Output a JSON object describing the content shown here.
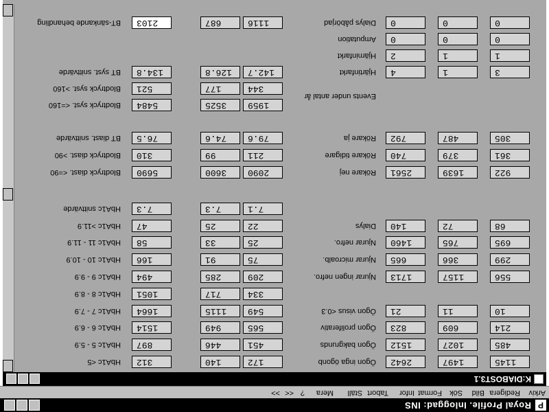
{
  "app": {
    "title": "Royal Profile. Inloggad: INS",
    "logo": "P"
  },
  "menu": [
    "Arkiv",
    "Redigera",
    "Bild",
    "Sök",
    "Format",
    "Infor",
    "Tabort",
    "Ställ",
    "Mera",
    "?",
    "<<",
    ">>"
  ],
  "document": {
    "title": "K:DIABOST3.1"
  },
  "left_section": {
    "groups": [
      {
        "rows": [
          {
            "label": "BT-sänkande behandling",
            "values": [
              "2103",
              "687",
              "1116"
            ]
          }
        ]
      },
      {
        "rows": [
          {
            "label": "BT syst. snittvärde",
            "values": [
              "134.8",
              "126.8",
              "142.7"
            ]
          },
          {
            "label": "Blodtryck syst. >160",
            "values": [
              "521",
              "177",
              "344"
            ]
          },
          {
            "label": "Blodtryck syst. <=160",
            "values": [
              "5484",
              "3525",
              "1959"
            ]
          }
        ]
      },
      {
        "rows": [
          {
            "label": "BT diast. snittvärde",
            "values": [
              "76.5",
              "74.6",
              "79.6"
            ]
          },
          {
            "label": "Blodtryck diast. >90",
            "values": [
              "310",
              "99",
              "211"
            ]
          },
          {
            "label": "Blodtryck diast. <=90",
            "values": [
              "5690",
              "3600",
              "2090"
            ]
          }
        ]
      },
      {
        "rows": [
          {
            "label": "HbA1c snittvärde",
            "values": [
              "7.3",
              "7.3",
              "7.1"
            ]
          },
          {
            "label": "HbA1c >11.9",
            "values": [
              "47",
              "25",
              "22"
            ]
          },
          {
            "label": "HbA1c 11 - 11.9",
            "values": [
              "58",
              "33",
              "25"
            ]
          },
          {
            "label": "HbA1c 10 - 10.9",
            "values": [
              "166",
              "91",
              "75"
            ]
          },
          {
            "label": "HbA1c 9 - 9.9",
            "values": [
              "494",
              "285",
              "209"
            ]
          },
          {
            "label": "HbA1c 8 - 8.9",
            "values": [
              "1051",
              "717",
              "334"
            ]
          },
          {
            "label": "HbA1c 7 - 7.9",
            "values": [
              "1664",
              "1115",
              "549"
            ]
          },
          {
            "label": "HbA1c 6 - 6.9",
            "values": [
              "1514",
              "949",
              "565"
            ]
          },
          {
            "label": "HbA1c 5 - 5.9",
            "values": [
              "897",
              "446",
              "451"
            ]
          },
          {
            "label": "HbA1c <5",
            "values": [
              "312",
              "140",
              "172"
            ]
          }
        ]
      }
    ]
  },
  "right_section": {
    "rows_top": [
      {
        "label": "Dialys påbörjad",
        "values": [
          "0",
          "0",
          "0"
        ]
      },
      {
        "label": "Amputation",
        "values": [
          "0",
          "0",
          "0"
        ]
      },
      {
        "label": "Hjärninfarkt",
        "values": [
          "2",
          "1",
          "1"
        ]
      },
      {
        "label": "Hjärtinfarkt",
        "values": [
          "4",
          "1",
          "3"
        ]
      }
    ],
    "events_caption": "Events under antal år",
    "rows_smoke": [
      {
        "label": "Rökare ja",
        "values": [
          "792",
          "487",
          "305"
        ]
      },
      {
        "label": "Rökare tidigare",
        "values": [
          "740",
          "379",
          "361"
        ]
      },
      {
        "label": "Rökare  nej",
        "values": [
          "2561",
          "1639",
          "922"
        ]
      }
    ],
    "rows_bottom": [
      {
        "label": "Dialys",
        "values": [
          "140",
          "72",
          "68"
        ]
      },
      {
        "label": "Njurar nefro.",
        "values": [
          "1460",
          "765",
          "695"
        ]
      },
      {
        "label": "Njurar microalb.",
        "values": [
          "665",
          "366",
          "299"
        ]
      },
      {
        "label": "Njurar ingen nefro.",
        "values": [
          "1713",
          "1157",
          "556"
        ]
      },
      {
        "label": "Ögon visus <0.3",
        "values": [
          "21",
          "11",
          "10"
        ]
      },
      {
        "label": "Ögon proliferativ",
        "values": [
          "823",
          "609",
          "214"
        ]
      },
      {
        "label": "Ögon bakgrunds",
        "values": [
          "1512",
          "1027",
          "485"
        ]
      },
      {
        "label": "Ögon inga ögonb",
        "values": [
          "2642",
          "1497",
          "1145"
        ]
      }
    ]
  }
}
